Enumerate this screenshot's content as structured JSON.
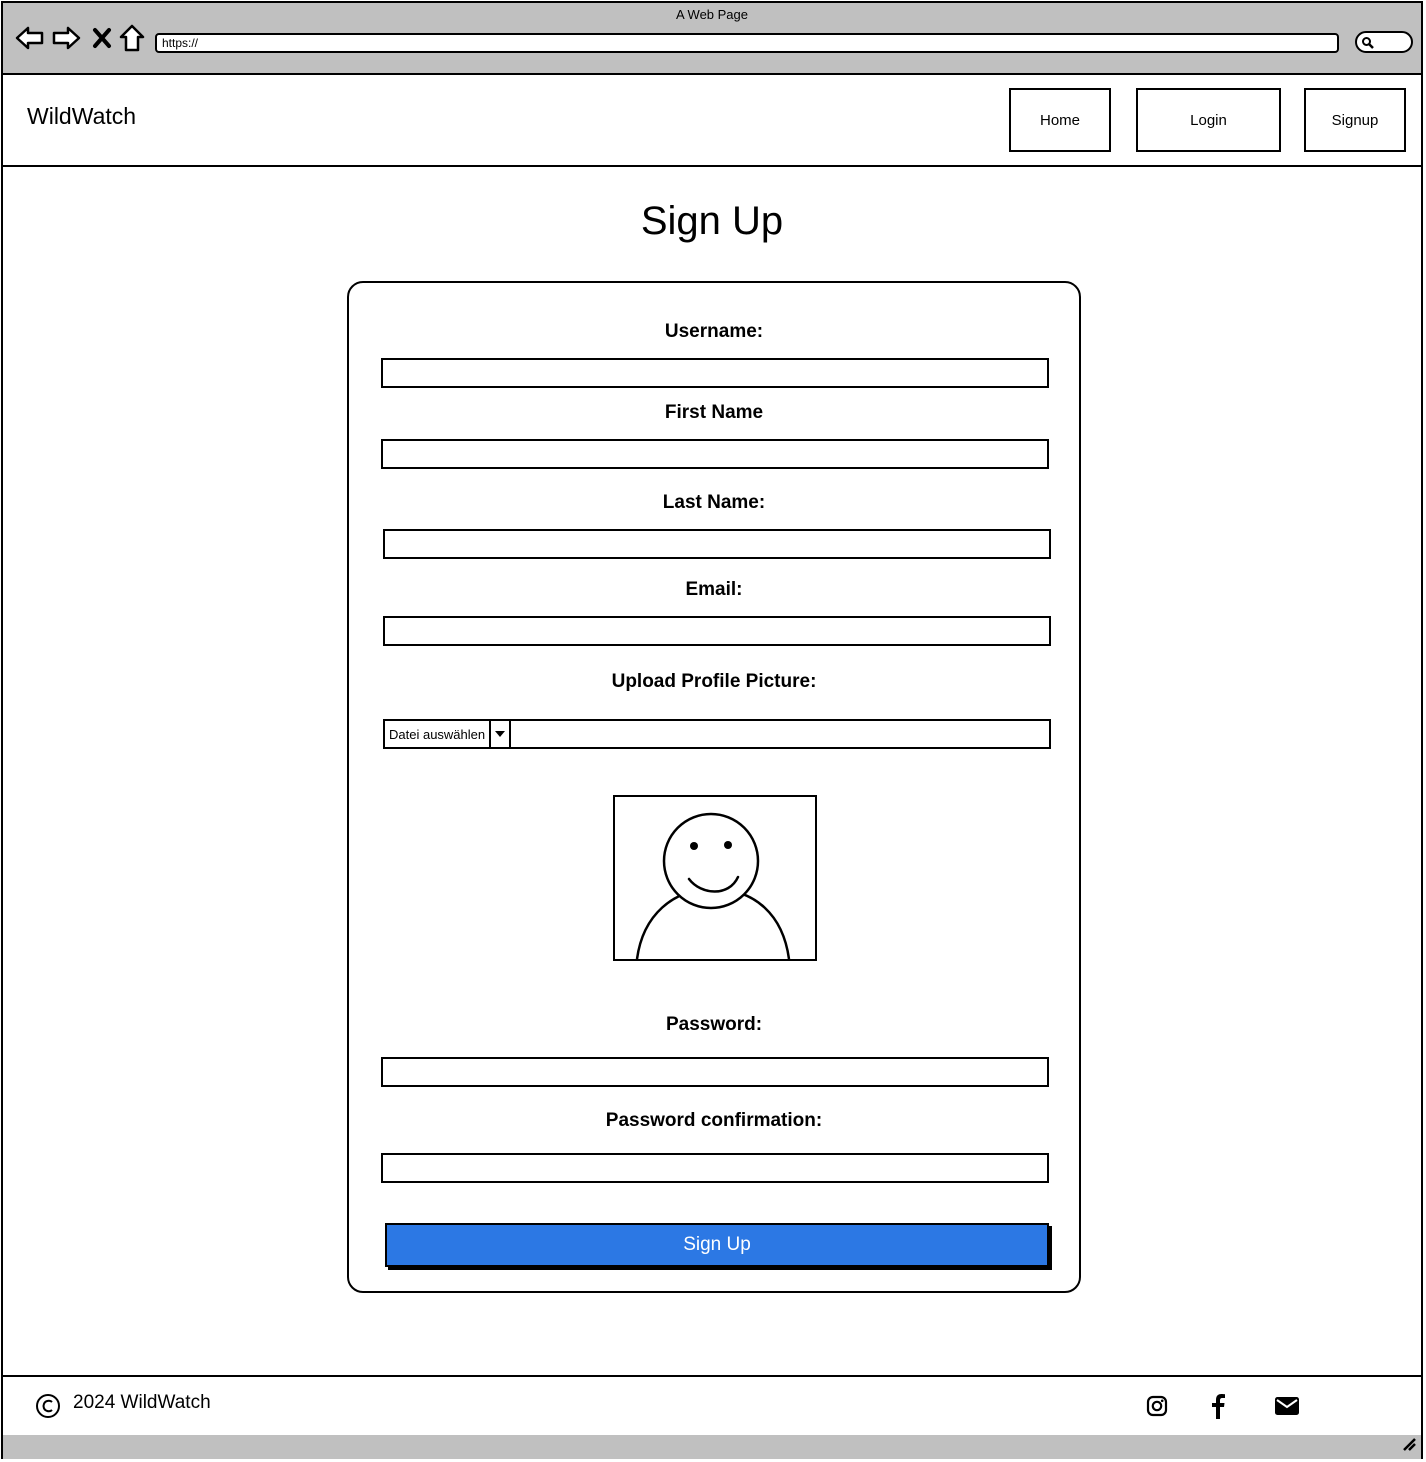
{
  "browser": {
    "title": "A Web Page",
    "url": "https://",
    "icons": [
      "back-icon",
      "forward-icon",
      "close-icon",
      "home-icon",
      "search-icon"
    ]
  },
  "header": {
    "brand": "WildWatch",
    "nav": [
      {
        "label": "Home"
      },
      {
        "label": "Login"
      },
      {
        "label": "Signup"
      }
    ]
  },
  "page": {
    "title": "Sign Up"
  },
  "form": {
    "username_label": "Username:",
    "firstname_label": "First Name",
    "lastname_label": "Last Name:",
    "email_label": "Email:",
    "upload_label": "Upload Profile Picture:",
    "file_button": "Datei auswählen",
    "password_label": "Password:",
    "password_confirm_label": "Password confirmation:",
    "submit_label": "Sign Up",
    "accent_color": "#2c78e4"
  },
  "footer": {
    "copyright": "2024 WildWatch",
    "social_icons": [
      "instagram-icon",
      "facebook-icon",
      "email-icon"
    ]
  }
}
